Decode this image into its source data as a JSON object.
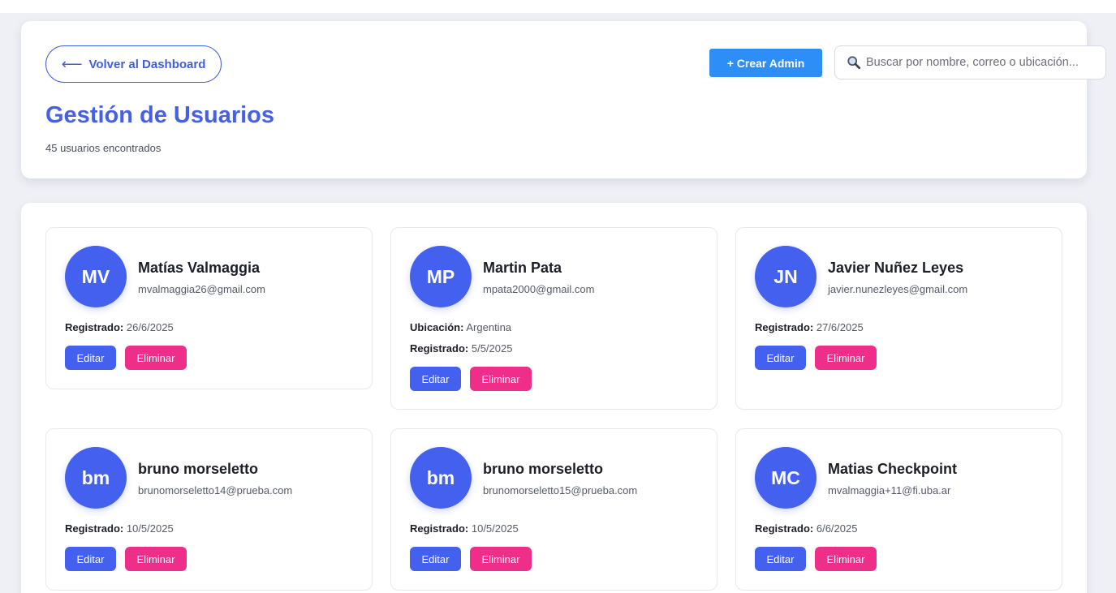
{
  "header": {
    "back_label": "Volver al Dashboard",
    "title": "Gestión de Usuarios",
    "count_text": "45 usuarios encontrados",
    "create_label": "+ Crear Admin",
    "search_placeholder": "Buscar por nombre, correo o ubicación..."
  },
  "labels": {
    "registered": "Registrado:",
    "location": "Ubicación:",
    "edit": "Editar",
    "delete": "Eliminar"
  },
  "users": [
    {
      "initials": "MV",
      "name": "Matías Valmaggia",
      "email": "mvalmaggia26@gmail.com",
      "registered": "26/6/2025"
    },
    {
      "initials": "MP",
      "name": "Martin Pata",
      "email": "mpata2000@gmail.com",
      "location": "Argentina",
      "registered": "5/5/2025"
    },
    {
      "initials": "JN",
      "name": "Javier Nuñez Leyes",
      "email": "javier.nunezleyes@gmail.com",
      "registered": "27/6/2025"
    },
    {
      "initials": "bm",
      "name": "bruno morseletto",
      "email": "brunomorseletto14@prueba.com",
      "registered": "10/5/2025"
    },
    {
      "initials": "bm",
      "name": "bruno morseletto",
      "email": "brunomorseletto15@prueba.com",
      "registered": "10/5/2025"
    },
    {
      "initials": "MC",
      "name": "Matias Checkpoint",
      "email": "mvalmaggia+11@fi.uba.ar",
      "registered": "6/6/2025"
    }
  ],
  "colors": {
    "primary": "#4460ee",
    "title": "#4560e6",
    "create_button": "#2e8ef7",
    "delete_button": "#ef2e8a",
    "background": "#eef0f5"
  },
  "icons": {
    "back": "arrow-left-icon",
    "search": "magnifying-glass-icon"
  }
}
